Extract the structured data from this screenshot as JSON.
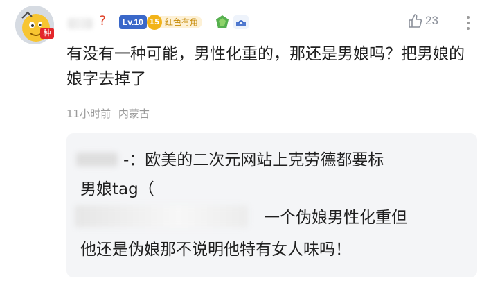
{
  "comment": {
    "avatar_badge": "种",
    "username_mark": "?",
    "level": "Lv.10",
    "fan_badge_level": "15",
    "fan_badge_label": "红色有角",
    "likes": "23",
    "text": "有没有一种可能，男性化重的，那还是男娘吗？把男娘的娘字去掉了",
    "time": "11小时前",
    "location": "内蒙古"
  },
  "reply": {
    "line1": "-：欧美的二次元网站上克劳德都要标",
    "line2": "男娘tag（",
    "line3": "一个伪娘男性化重但",
    "line4": "他还是伪娘那不说明他特有女人味吗！"
  },
  "icons": [
    "avatar-emoji",
    "gem-icon",
    "libra-icon",
    "thumbs-up-icon",
    "more-vertical-icon"
  ]
}
